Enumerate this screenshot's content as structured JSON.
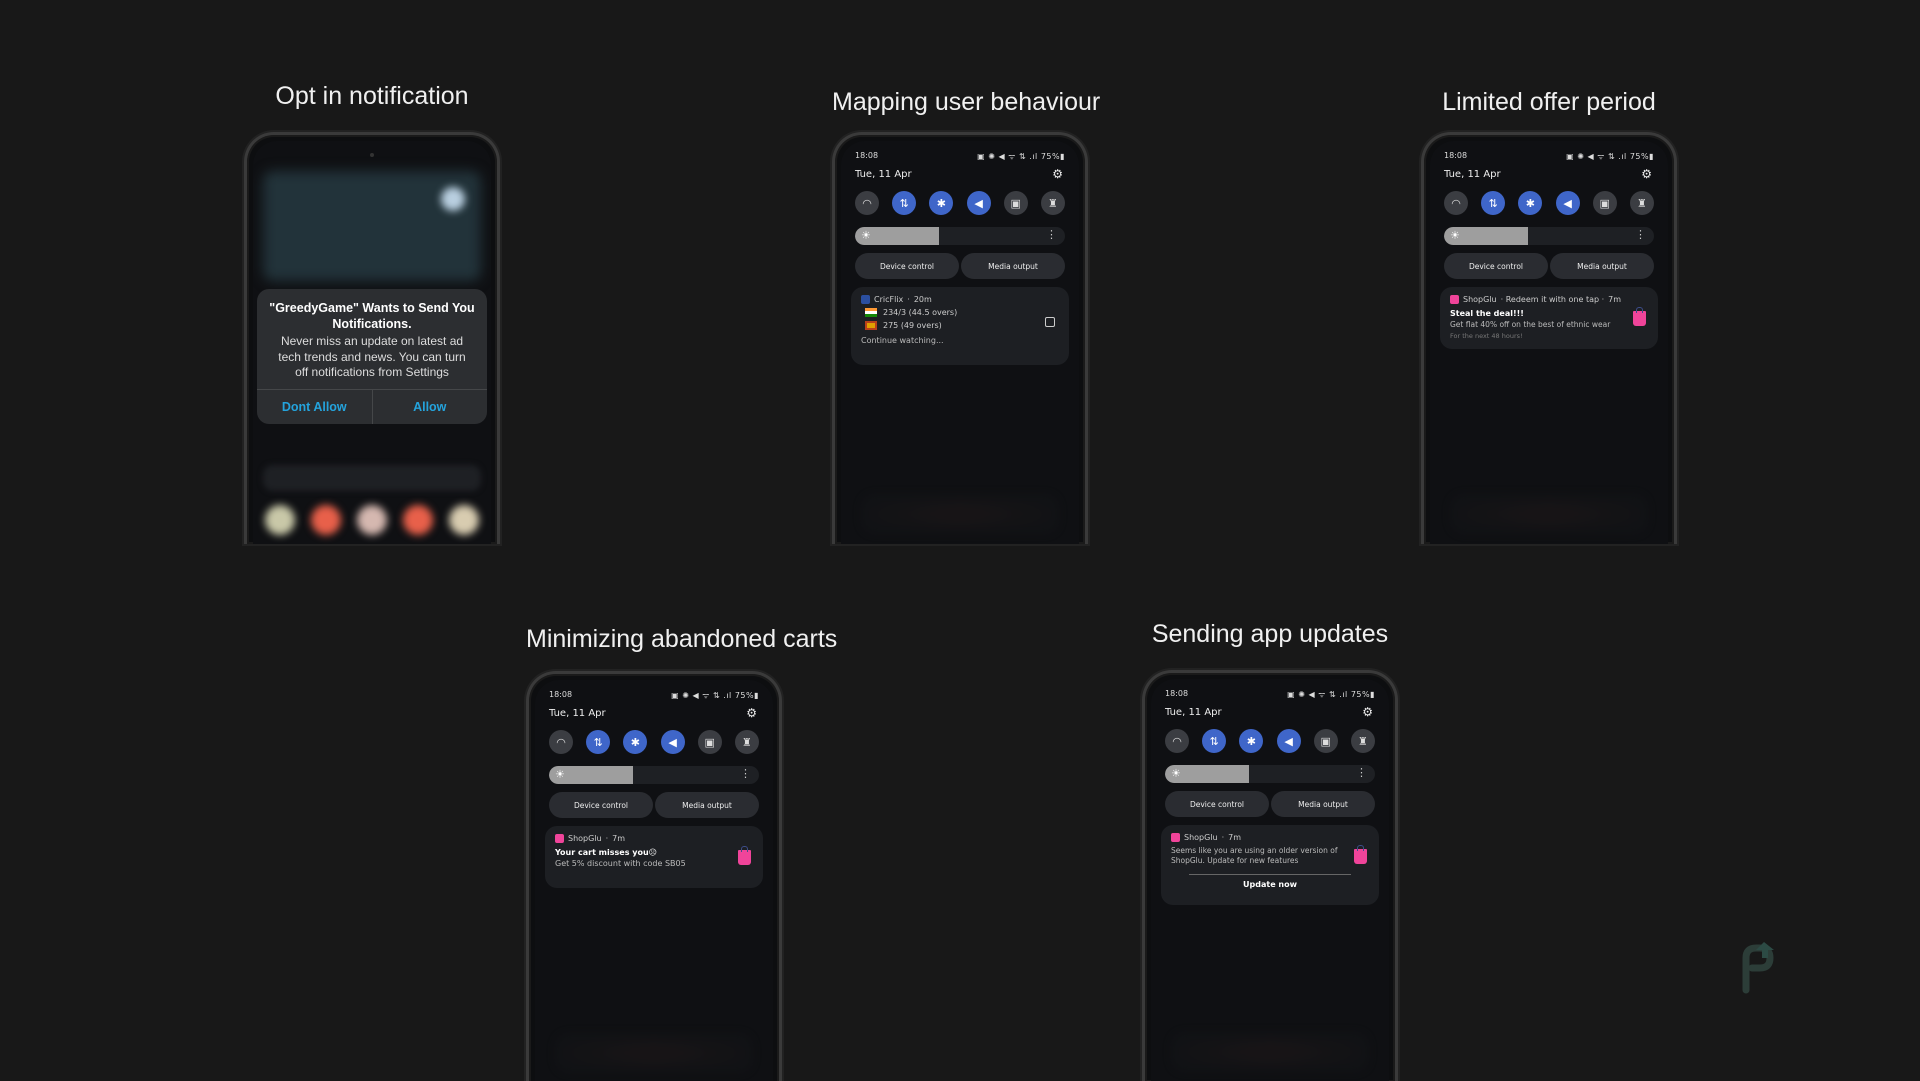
{
  "status_bar": {
    "time": "18:08",
    "icons": "▣ ✺ ◀ ᯤ ⇅ .ıl",
    "battery": "75%▮",
    "date": "Tue, 11 Apr"
  },
  "quick_settings": {
    "toggles": [
      {
        "name": "wifi",
        "glyph": "◠",
        "on": false
      },
      {
        "name": "mobile-data",
        "glyph": "⇅",
        "on": true
      },
      {
        "name": "bluetooth",
        "glyph": "✱",
        "on": true
      },
      {
        "name": "sound-mute",
        "glyph": "◀",
        "on": true
      },
      {
        "name": "screen-lock",
        "glyph": "▣",
        "on": false
      },
      {
        "name": "flashlight",
        "glyph": "♜",
        "on": false
      }
    ],
    "brightness_level": 0.4,
    "device_control": "Device control",
    "media_output": "Media output"
  },
  "cards": [
    {
      "title": "Opt in notification",
      "alert": {
        "title": "\"GreedyGame\" Wants to Send You Notifications.",
        "body": "Never miss an update on latest ad tech trends and news. You can turn off notifications from Settings",
        "deny": "Dont Allow",
        "allow": "Allow"
      }
    },
    {
      "title": "Mapping user behaviour",
      "notification": {
        "app": "CricFlix",
        "sep": "·",
        "age": "20m",
        "score1": "234/3   (44.5 overs)",
        "score2": "275   (49 overs)",
        "footer": "Continue watching..."
      }
    },
    {
      "title": "Limited offer period",
      "notification": {
        "app": "ShopGlu",
        "tagline": "· Redeem it with one tap ·",
        "age": "7m",
        "title": "Steal the deal!!!",
        "body": "Get flat 40% off on the best of ethnic wear",
        "sub": "For the next 48 hours!"
      }
    },
    {
      "title": "Minimizing abandoned carts",
      "notification": {
        "app": "ShopGlu",
        "sep": "·",
        "age": "7m",
        "title": "Your cart misses you☹",
        "body": "Get 5% discount with code SB05"
      }
    },
    {
      "title": "Sending app updates",
      "notification": {
        "app": "ShopGlu",
        "sep": "·",
        "age": "7m",
        "body": "Seems like you are using an older version of ShopGlu. Update for new features",
        "action": "Update now"
      }
    }
  ],
  "colors": {
    "background": "#181818",
    "toggle_on": "#3f66c9",
    "alert_button": "#24a3dc",
    "shop_pink": "#f0449a",
    "logo": "#2c3d38"
  }
}
